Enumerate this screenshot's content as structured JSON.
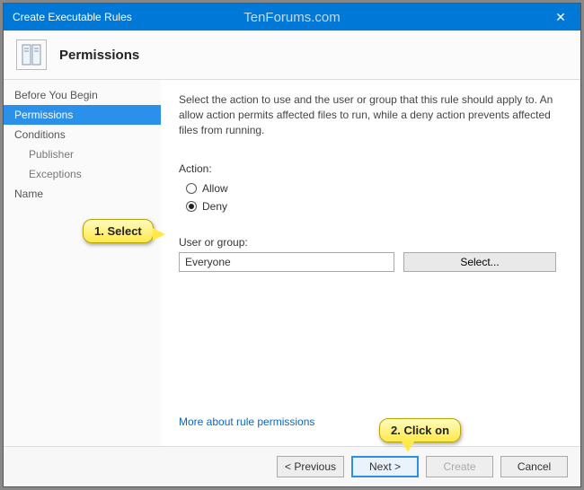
{
  "titlebar": {
    "title": "Create Executable Rules",
    "watermark": "TenForums.com"
  },
  "header": {
    "title": "Permissions"
  },
  "sidebar": {
    "items": [
      {
        "label": "Before You Begin",
        "indent": false
      },
      {
        "label": "Permissions",
        "indent": false,
        "selected": true
      },
      {
        "label": "Conditions",
        "indent": false
      },
      {
        "label": "Publisher",
        "indent": true
      },
      {
        "label": "Exceptions",
        "indent": true
      },
      {
        "label": "Name",
        "indent": false
      }
    ]
  },
  "main": {
    "description": "Select the action to use and the user or group that this rule should apply to. An allow action permits affected files to run, while a deny action prevents affected files from running.",
    "action_label": "Action:",
    "allow_label": "Allow",
    "deny_label": "Deny",
    "group_label": "User or group:",
    "group_value": "Everyone",
    "select_btn": "Select...",
    "link": "More about rule permissions"
  },
  "footer": {
    "prev": "< Previous",
    "next": "Next >",
    "create": "Create",
    "cancel": "Cancel"
  },
  "annotations": {
    "step1": "1. Select",
    "step2": "2. Click on"
  }
}
